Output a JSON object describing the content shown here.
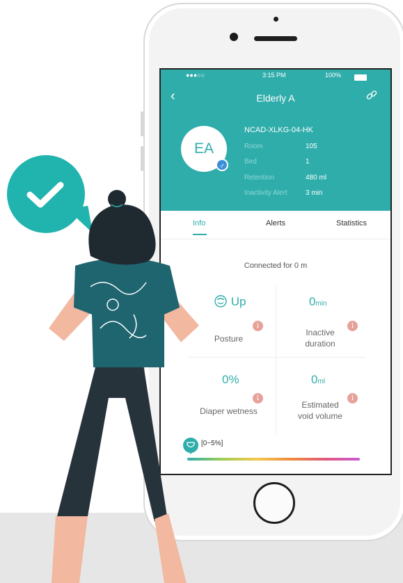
{
  "status_bar": {
    "signal": "●●●○○",
    "time": "3:15 PM",
    "battery": "100%"
  },
  "header": {
    "title": "Elderly A"
  },
  "profile": {
    "initials": "EA",
    "gender_symbol": "♂",
    "device_id": "NCAD-XLKG-04-HK",
    "fields": [
      {
        "label": "Room",
        "value": "105"
      },
      {
        "label": "Bed",
        "value": "1"
      },
      {
        "label": "Retention",
        "value": "480 ml"
      },
      {
        "label": "Inactivity Alert",
        "value": "3 min"
      }
    ]
  },
  "tabs": [
    {
      "label": "Info",
      "active": true
    },
    {
      "label": "Alerts",
      "active": false
    },
    {
      "label": "Statistics",
      "active": false
    }
  ],
  "connection": {
    "text": "Connected for 0 m"
  },
  "metrics": {
    "posture": {
      "value": "Up",
      "label": "Posture"
    },
    "inactive": {
      "value": "0",
      "unit": "min",
      "label_line1": "Inactive",
      "label_line2": "duration"
    },
    "wetness": {
      "value": "0%",
      "label": "Diaper wetness"
    },
    "void": {
      "value": "0",
      "unit": "ml",
      "label_line1": "Estimated",
      "label_line2": "void volume"
    }
  },
  "info_badge": "i",
  "wetness_scale": {
    "range_label": "[0~5%]"
  },
  "colors": {
    "accent": "#2fadab",
    "info_badge": "#e6a19a",
    "bubble": "#21b3ad"
  },
  "icons": [
    "back-chevron-icon",
    "link-icon",
    "posture-face-icon",
    "diaper-icon",
    "checkmark-icon"
  ]
}
